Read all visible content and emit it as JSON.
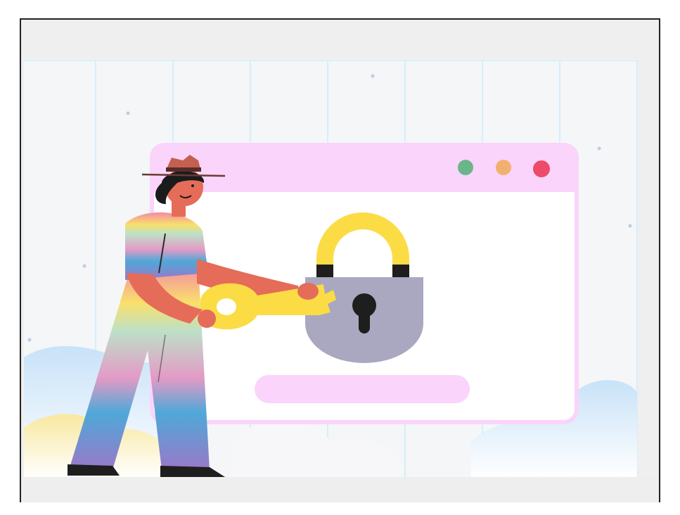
{
  "illustration": {
    "subject": "person-unlocking-padlock-with-key",
    "icons": [
      "padlock-icon",
      "key-icon",
      "keyhole-icon"
    ]
  },
  "browser_window": {
    "dots": [
      {
        "name": "green-dot",
        "color": "#6bb58a"
      },
      {
        "name": "orange-dot",
        "color": "#f1b070"
      },
      {
        "name": "red-dot",
        "color": "#ee4a6a"
      }
    ],
    "title_bar_color": "#fad4fa",
    "body_color": "#ffffff"
  },
  "colors": {
    "background": "#efefef",
    "grid_line": "#d6eefa",
    "lock_body": "#a9a8c0",
    "lock_shackle": "#fbdc45",
    "key": "#fbdc45",
    "skin": "#e56c58",
    "hat": "#c46050",
    "hair": "#1b1b1b",
    "input_bar": "#fad4fa"
  }
}
